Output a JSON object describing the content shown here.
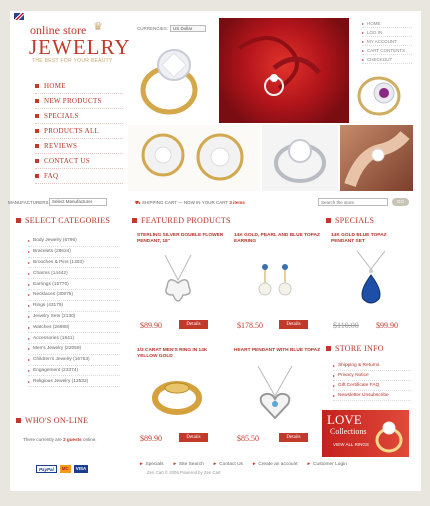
{
  "header": {
    "logo_small": "online store",
    "logo_big": "JEWELRY",
    "logo_tagline": "THE BEST FOR YOUR BEAUTY",
    "menu": [
      {
        "label": "HOME"
      },
      {
        "label": "NEW PRODUCTS"
      },
      {
        "label": "SPECIALS"
      },
      {
        "label": "PRODUCTS ALL"
      },
      {
        "label": "REVIEWS"
      },
      {
        "label": "CONTACT US"
      },
      {
        "label": "FAQ"
      }
    ],
    "currencies_label": "CURRENCIES:",
    "currency_value": "US Dollar",
    "top_links": [
      {
        "label": "HOME"
      },
      {
        "label": "LOG IN"
      },
      {
        "label": "MY ACCOUNT"
      },
      {
        "label": "CART CONTENTS"
      },
      {
        "label": "CHECKOUT"
      }
    ]
  },
  "search_bar": {
    "manufacturers_label": "MANUFACTURERS:",
    "manufacturers_value": "Select Manufacturer",
    "shipping_text": "SHIPPING CART",
    "cart_text": "NOW IN YOUR CART",
    "cart_items": "3 items",
    "search_placeholder": "Search the store",
    "go_label": "GO"
  },
  "categories": {
    "title": "SELECT CATEGORIES",
    "items": [
      {
        "label": "Body Jewelry (6796)"
      },
      {
        "label": "Bracelets (28624)"
      },
      {
        "label": "Brooches & Pins (1303)"
      },
      {
        "label": "Charms (14442)"
      },
      {
        "label": "Earrings (15770)"
      },
      {
        "label": "Necklaces (30876)"
      },
      {
        "label": "Rings (43179)"
      },
      {
        "label": "Jewelry Sets (2130)"
      },
      {
        "label": "Watches (26988)"
      },
      {
        "label": "Accessories (1641)"
      },
      {
        "label": "Men's Jewelry (22059)"
      },
      {
        "label": "Children's Jewelry (16753)"
      },
      {
        "label": "Engagement (23374)"
      },
      {
        "label": "Religious Jewelry (13532)"
      }
    ]
  },
  "whos_online": {
    "title": "WHO'S ON-LINE",
    "text_before": "There currently are",
    "guests": "2 guests",
    "text_after": "online."
  },
  "payment": {
    "paypal": "PayPal",
    "mastercard": "MC",
    "visa": "VISA"
  },
  "featured": {
    "title": "FEATURED PRODUCTS",
    "details_label": "Details",
    "products": [
      {
        "name": "STERLING SILVER DOUBLE FLOWER PENDANT, 18\"",
        "price": "$89.90"
      },
      {
        "name": "14K GOLD, PEARL AND BLUE TOPAZ EARRING",
        "price": "$178.50"
      },
      {
        "name": "1/3 CARAT MEN'S RING IN 14K YELLOW GOLD",
        "price": "$89.90"
      },
      {
        "name": "HEART PENDANT WITH BLUE TOPAZ",
        "price": "$85.50"
      }
    ]
  },
  "specials": {
    "title": "SPECIALS",
    "product": {
      "name": "14K GOLD BLUE TOPAZ PENDANT SET",
      "old_price": "$110.00",
      "price": "$99.90"
    }
  },
  "store_info": {
    "title": "STORE INFO",
    "items": [
      {
        "label": "Shipping & Returns"
      },
      {
        "label": "Privacy Notice"
      },
      {
        "label": "Gift Certificate FAQ"
      },
      {
        "label": "Newsletter Unsubscribe"
      }
    ]
  },
  "banner": {
    "line1": "LOVE",
    "line2": "Collections",
    "line3": "VIEW ALL RINGS"
  },
  "footer": {
    "links": [
      {
        "label": "Specials"
      },
      {
        "label": "Site Search"
      },
      {
        "label": "Contact Us"
      },
      {
        "label": "Create an account"
      },
      {
        "label": "Customer Login"
      }
    ],
    "copyright": "Zen Cart © 2006 Powered by Zen Cart"
  },
  "colors": {
    "accent": "#c0392b",
    "gold": "#c9a874",
    "background": "#e9e6e0"
  }
}
